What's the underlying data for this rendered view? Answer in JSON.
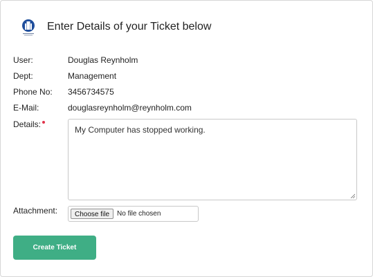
{
  "header": {
    "logo_icon": "university-crest-icon",
    "title": "Enter Details of your Ticket below"
  },
  "fields": [
    {
      "label": "User:",
      "value": "Douglas Reynholm"
    },
    {
      "label": "Dept:",
      "value": "Management"
    },
    {
      "label": "Phone No:",
      "value": "3456734575"
    },
    {
      "label": "E-Mail:",
      "value": "douglasreynholm@reynholm.com"
    }
  ],
  "details": {
    "label": "Details:",
    "required": true,
    "value": "My Computer has stopped working."
  },
  "attachment": {
    "label": "Attachment:",
    "button_label": "Choose file",
    "status": "No file chosen"
  },
  "submit_label": "Create Ticket",
  "colors": {
    "accent": "#3fae85",
    "required_marker": "#e0334a",
    "logo_blue": "#1f4e9c"
  }
}
